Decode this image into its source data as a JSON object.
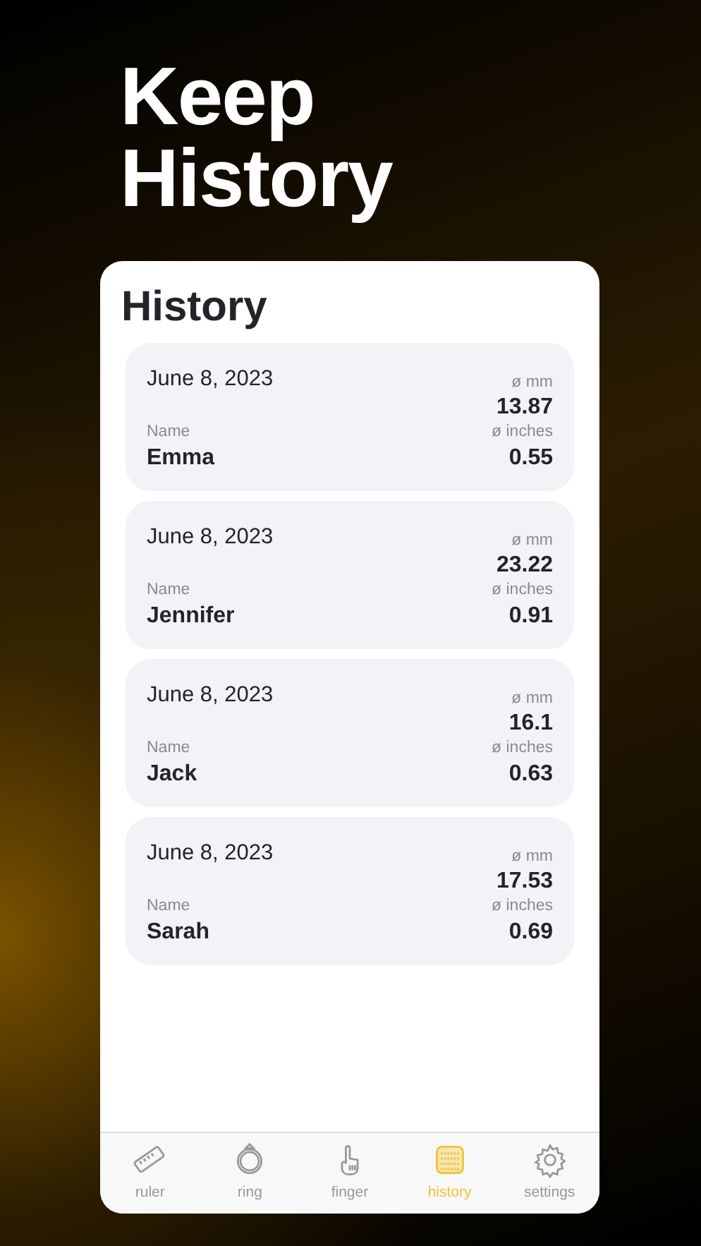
{
  "headline": "Keep History",
  "screen_title": "History",
  "records": [
    {
      "date": "June 8, 2023",
      "name_label": "Name",
      "name": "Emma",
      "mm_label": "ø mm",
      "mm": "13.87",
      "inch_label": "ø inches",
      "inches": "0.55"
    },
    {
      "date": "June 8, 2023",
      "name_label": "Name",
      "name": "Jennifer",
      "mm_label": "ø mm",
      "mm": "23.22",
      "inch_label": "ø inches",
      "inches": "0.91"
    },
    {
      "date": "June 8, 2023",
      "name_label": "Name",
      "name": "Jack",
      "mm_label": "ø mm",
      "mm": "16.1",
      "inch_label": "ø inches",
      "inches": "0.63"
    },
    {
      "date": "June 8, 2023",
      "name_label": "Name",
      "name": "Sarah",
      "mm_label": "ø mm",
      "mm": "17.53",
      "inch_label": "ø inches",
      "inches": "0.69"
    }
  ],
  "tabs": [
    {
      "kind": "ruler",
      "label": "ruler",
      "selected": false
    },
    {
      "kind": "ring",
      "label": "ring",
      "selected": false
    },
    {
      "kind": "finger",
      "label": "finger",
      "selected": false
    },
    {
      "kind": "history",
      "label": "history",
      "selected": true
    },
    {
      "kind": "settings",
      "label": "settings",
      "selected": false
    }
  ]
}
